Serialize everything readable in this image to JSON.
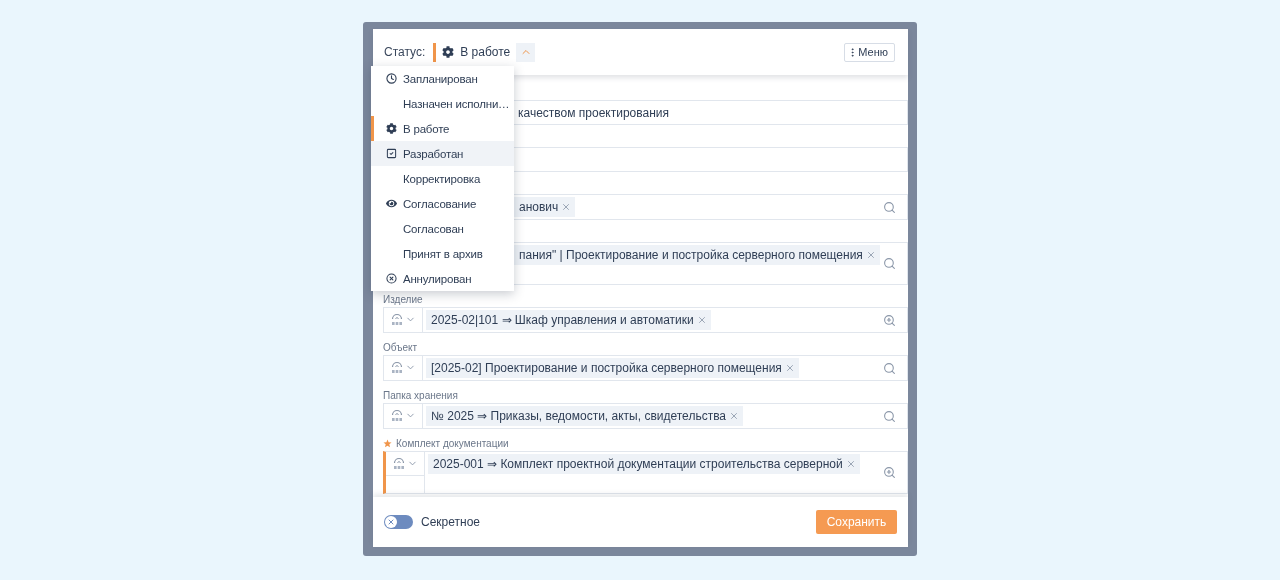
{
  "header": {
    "status_label": "Статус:",
    "status_value": "В работе",
    "expanded": true,
    "menu_button": "Меню"
  },
  "status_menu": [
    {
      "label": "Запланирован",
      "kind": "clock",
      "selected": false,
      "hovered": false
    },
    {
      "label": "Назначен исполни…",
      "kind": "plain",
      "selected": false,
      "hovered": false
    },
    {
      "label": "В работе",
      "kind": "gear",
      "selected": true,
      "hovered": false
    },
    {
      "label": "Разработан",
      "kind": "check",
      "selected": false,
      "hovered": true
    },
    {
      "label": "Корректировка",
      "kind": "plain",
      "selected": false,
      "hovered": false
    },
    {
      "label": "Согласование",
      "kind": "eye",
      "selected": false,
      "hovered": false
    },
    {
      "label": "Согласован",
      "kind": "plain",
      "selected": false,
      "hovered": false
    },
    {
      "label": "Принят в архив",
      "kind": "plain",
      "selected": false,
      "hovered": false
    },
    {
      "label": "Аннулирован",
      "kind": "cancel",
      "selected": false,
      "hovered": false
    }
  ],
  "fields": [
    {
      "kind": "text",
      "clipped": true,
      "value": "качеством проектирования"
    },
    {
      "kind": "text"
    },
    {
      "kind": "search",
      "clipped": true,
      "tags": [
        "анович"
      ]
    },
    {
      "kind": "search",
      "clipped": true,
      "tall": true,
      "tags": [
        "пания\" | Проектирование и постройка серверного помещения"
      ]
    },
    {
      "kind": "zoom",
      "label": "Изделие",
      "tags": [
        "2025-02|101 ⇒ Шкаф управления и автоматики"
      ]
    },
    {
      "kind": "search",
      "label": "Объект",
      "tags": [
        "[2025-02] Проектирование и постройка серверного помещения"
      ]
    },
    {
      "kind": "search",
      "label": "Папка хранения",
      "tags": [
        "№ 2025 ⇒ Приказы, ведомости, акты, свидетельства"
      ]
    },
    {
      "kind": "zoom",
      "label": "Комплект документации",
      "required": true,
      "tall": true,
      "tags": [
        "2025-001 ⇒ Комплект проектной документации строительства серверной"
      ]
    }
  ],
  "footer": {
    "secret_label": "Секретное",
    "secret_on": false,
    "save_button": "Сохранить"
  }
}
